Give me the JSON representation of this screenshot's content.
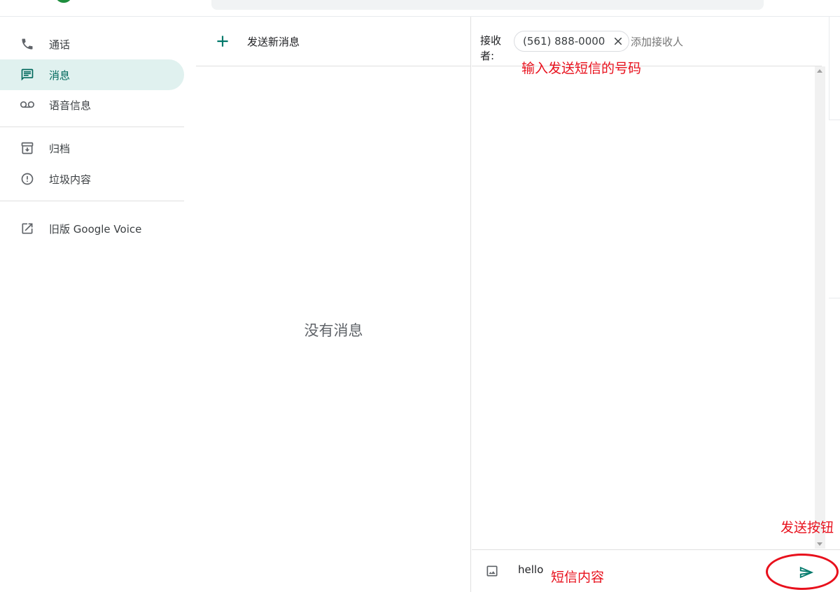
{
  "sidebar": {
    "items": [
      {
        "label": "通话",
        "icon": "phone-icon",
        "active": false
      },
      {
        "label": "消息",
        "icon": "message-icon",
        "active": true
      },
      {
        "label": "语音信息",
        "icon": "voicemail-icon",
        "active": false
      },
      {
        "label": "归档",
        "icon": "archive-icon",
        "active": false
      },
      {
        "label": "垃圾内容",
        "icon": "spam-icon",
        "active": false
      },
      {
        "label": "旧版 Google Voice",
        "icon": "open-external-icon",
        "active": false
      }
    ]
  },
  "middle": {
    "new_message_label": "发送新消息",
    "empty_text": "没有消息"
  },
  "compose": {
    "to_label": "接收者:",
    "recipient_chip": "(561) 888-0000",
    "add_recipient_placeholder": "添加接收人",
    "message_text": "hello"
  },
  "annotations": {
    "number_hint": "输入发送短信的号码",
    "content_hint": "短信内容",
    "send_hint": "发送按钮"
  },
  "colors": {
    "accent": "#00695c",
    "active_bg": "#e0f1ef",
    "annotation": "#e8101c"
  }
}
